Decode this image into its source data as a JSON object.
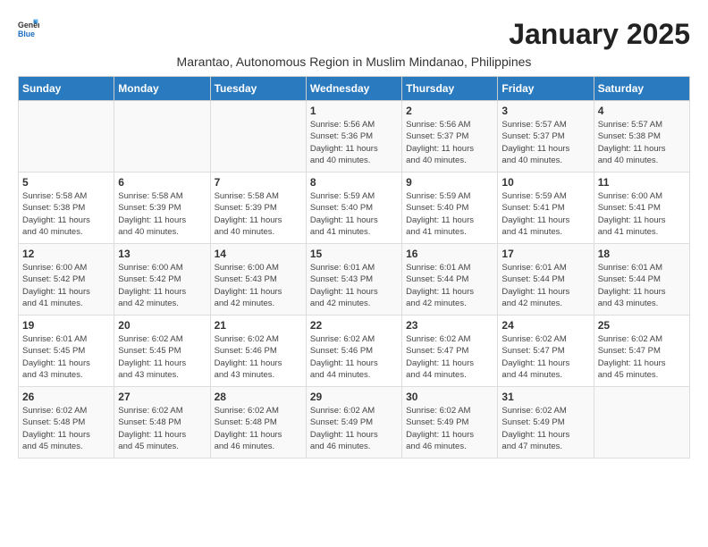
{
  "header": {
    "logo_general": "General",
    "logo_blue": "Blue",
    "month_title": "January 2025",
    "subtitle": "Marantao, Autonomous Region in Muslim Mindanao, Philippines"
  },
  "weekdays": [
    "Sunday",
    "Monday",
    "Tuesday",
    "Wednesday",
    "Thursday",
    "Friday",
    "Saturday"
  ],
  "weeks": [
    [
      {
        "day": "",
        "info": ""
      },
      {
        "day": "",
        "info": ""
      },
      {
        "day": "",
        "info": ""
      },
      {
        "day": "1",
        "info": "Sunrise: 5:56 AM\nSunset: 5:36 PM\nDaylight: 11 hours\nand 40 minutes."
      },
      {
        "day": "2",
        "info": "Sunrise: 5:56 AM\nSunset: 5:37 PM\nDaylight: 11 hours\nand 40 minutes."
      },
      {
        "day": "3",
        "info": "Sunrise: 5:57 AM\nSunset: 5:37 PM\nDaylight: 11 hours\nand 40 minutes."
      },
      {
        "day": "4",
        "info": "Sunrise: 5:57 AM\nSunset: 5:38 PM\nDaylight: 11 hours\nand 40 minutes."
      }
    ],
    [
      {
        "day": "5",
        "info": "Sunrise: 5:58 AM\nSunset: 5:38 PM\nDaylight: 11 hours\nand 40 minutes."
      },
      {
        "day": "6",
        "info": "Sunrise: 5:58 AM\nSunset: 5:39 PM\nDaylight: 11 hours\nand 40 minutes."
      },
      {
        "day": "7",
        "info": "Sunrise: 5:58 AM\nSunset: 5:39 PM\nDaylight: 11 hours\nand 40 minutes."
      },
      {
        "day": "8",
        "info": "Sunrise: 5:59 AM\nSunset: 5:40 PM\nDaylight: 11 hours\nand 41 minutes."
      },
      {
        "day": "9",
        "info": "Sunrise: 5:59 AM\nSunset: 5:40 PM\nDaylight: 11 hours\nand 41 minutes."
      },
      {
        "day": "10",
        "info": "Sunrise: 5:59 AM\nSunset: 5:41 PM\nDaylight: 11 hours\nand 41 minutes."
      },
      {
        "day": "11",
        "info": "Sunrise: 6:00 AM\nSunset: 5:41 PM\nDaylight: 11 hours\nand 41 minutes."
      }
    ],
    [
      {
        "day": "12",
        "info": "Sunrise: 6:00 AM\nSunset: 5:42 PM\nDaylight: 11 hours\nand 41 minutes."
      },
      {
        "day": "13",
        "info": "Sunrise: 6:00 AM\nSunset: 5:42 PM\nDaylight: 11 hours\nand 42 minutes."
      },
      {
        "day": "14",
        "info": "Sunrise: 6:00 AM\nSunset: 5:43 PM\nDaylight: 11 hours\nand 42 minutes."
      },
      {
        "day": "15",
        "info": "Sunrise: 6:01 AM\nSunset: 5:43 PM\nDaylight: 11 hours\nand 42 minutes."
      },
      {
        "day": "16",
        "info": "Sunrise: 6:01 AM\nSunset: 5:44 PM\nDaylight: 11 hours\nand 42 minutes."
      },
      {
        "day": "17",
        "info": "Sunrise: 6:01 AM\nSunset: 5:44 PM\nDaylight: 11 hours\nand 42 minutes."
      },
      {
        "day": "18",
        "info": "Sunrise: 6:01 AM\nSunset: 5:44 PM\nDaylight: 11 hours\nand 43 minutes."
      }
    ],
    [
      {
        "day": "19",
        "info": "Sunrise: 6:01 AM\nSunset: 5:45 PM\nDaylight: 11 hours\nand 43 minutes."
      },
      {
        "day": "20",
        "info": "Sunrise: 6:02 AM\nSunset: 5:45 PM\nDaylight: 11 hours\nand 43 minutes."
      },
      {
        "day": "21",
        "info": "Sunrise: 6:02 AM\nSunset: 5:46 PM\nDaylight: 11 hours\nand 43 minutes."
      },
      {
        "day": "22",
        "info": "Sunrise: 6:02 AM\nSunset: 5:46 PM\nDaylight: 11 hours\nand 44 minutes."
      },
      {
        "day": "23",
        "info": "Sunrise: 6:02 AM\nSunset: 5:47 PM\nDaylight: 11 hours\nand 44 minutes."
      },
      {
        "day": "24",
        "info": "Sunrise: 6:02 AM\nSunset: 5:47 PM\nDaylight: 11 hours\nand 44 minutes."
      },
      {
        "day": "25",
        "info": "Sunrise: 6:02 AM\nSunset: 5:47 PM\nDaylight: 11 hours\nand 45 minutes."
      }
    ],
    [
      {
        "day": "26",
        "info": "Sunrise: 6:02 AM\nSunset: 5:48 PM\nDaylight: 11 hours\nand 45 minutes."
      },
      {
        "day": "27",
        "info": "Sunrise: 6:02 AM\nSunset: 5:48 PM\nDaylight: 11 hours\nand 45 minutes."
      },
      {
        "day": "28",
        "info": "Sunrise: 6:02 AM\nSunset: 5:48 PM\nDaylight: 11 hours\nand 46 minutes."
      },
      {
        "day": "29",
        "info": "Sunrise: 6:02 AM\nSunset: 5:49 PM\nDaylight: 11 hours\nand 46 minutes."
      },
      {
        "day": "30",
        "info": "Sunrise: 6:02 AM\nSunset: 5:49 PM\nDaylight: 11 hours\nand 46 minutes."
      },
      {
        "day": "31",
        "info": "Sunrise: 6:02 AM\nSunset: 5:49 PM\nDaylight: 11 hours\nand 47 minutes."
      },
      {
        "day": "",
        "info": ""
      }
    ]
  ]
}
